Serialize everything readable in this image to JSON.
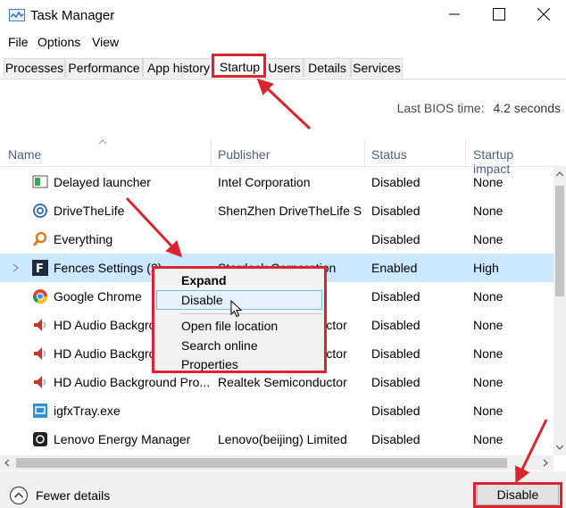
{
  "window": {
    "title": "Task Manager",
    "minimize_icon": "minimize-icon",
    "maximize_icon": "maximize-icon",
    "close_icon": "close-icon"
  },
  "menu": [
    "File",
    "Options",
    "View"
  ],
  "tabs": [
    "Processes",
    "Performance",
    "App history",
    "Startup",
    "Users",
    "Details",
    "Services"
  ],
  "active_tab": "Startup",
  "bios": {
    "label": "Last BIOS time:",
    "value": "4.2 seconds"
  },
  "columns": [
    "Name",
    "Publisher",
    "Status",
    "Startup impact"
  ],
  "rows": [
    {
      "name": "Delayed launcher",
      "publisher": "Intel Corporation",
      "status": "Disabled",
      "impact": "None",
      "icon": "intel-launcher-icon"
    },
    {
      "name": "DriveTheLife",
      "publisher": "ShenZhen DriveTheLife S...",
      "status": "Disabled",
      "impact": "None",
      "icon": "gear-icon"
    },
    {
      "name": "Everything",
      "publisher": "",
      "status": "Disabled",
      "impact": "None",
      "icon": "search-icon"
    },
    {
      "name": "Fences Settings (2)",
      "publisher": "Stardock Corporation",
      "status": "Enabled",
      "impact": "High",
      "icon": "fences-icon"
    },
    {
      "name": "Google Chrome",
      "publisher": "",
      "status": "Disabled",
      "impact": "None",
      "icon": "chrome-icon"
    },
    {
      "name": "HD Audio Backgrou...",
      "publisher": "Realtek Semiconductor",
      "status": "Disabled",
      "impact": "None",
      "icon": "speaker-icon"
    },
    {
      "name": "HD Audio Backgrou...",
      "publisher": "Realtek Semiconductor",
      "status": "Disabled",
      "impact": "None",
      "icon": "speaker-icon"
    },
    {
      "name": "HD Audio Background Pro...",
      "publisher": "Realtek Semiconductor",
      "status": "Disabled",
      "impact": "None",
      "icon": "speaker-icon"
    },
    {
      "name": "igfxTray.exe",
      "publisher": "",
      "status": "Disabled",
      "impact": "None",
      "icon": "graphics-tray-icon"
    },
    {
      "name": "Lenovo Energy Manager",
      "publisher": "Lenovo(beijing) Limited",
      "status": "Disabled",
      "impact": "None",
      "icon": "energy-icon"
    }
  ],
  "context_menu": [
    "Expand",
    "Disable",
    "Open file location",
    "Search online",
    "Properties"
  ],
  "footer": {
    "fewer_details": "Fewer details",
    "disable_button": "Disable"
  },
  "colors": {
    "accent_red": "#d9262e",
    "selection": "#cce8ff",
    "header_text": "#4d6082"
  }
}
